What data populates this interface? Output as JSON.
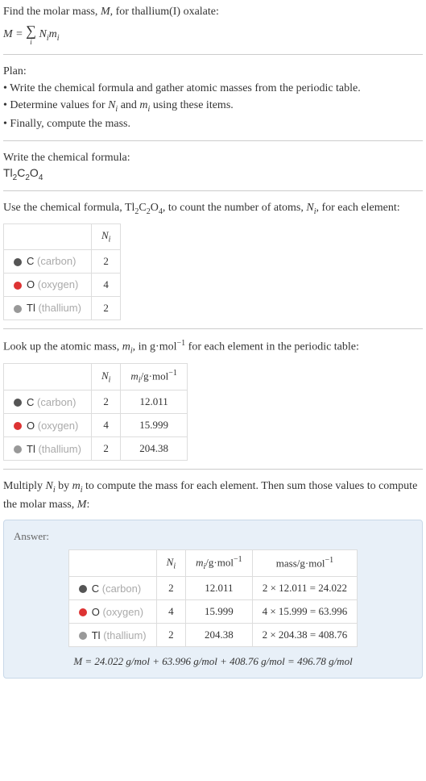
{
  "intro": {
    "line1_prefix": "Find the molar mass, ",
    "line1_var": "M",
    "line1_suffix": ", for thallium(I) oxalate:",
    "formula_lhs": "M",
    "formula_eq": " = ",
    "formula_sigma": "∑",
    "formula_sigma_sub": "i",
    "formula_rhs1": "N",
    "formula_rhs1_sub": "i",
    "formula_rhs2": "m",
    "formula_rhs2_sub": "i"
  },
  "plan": {
    "title": "Plan:",
    "bullet1": "• Write the chemical formula and gather atomic masses from the periodic table.",
    "bullet2_prefix": "• Determine values for ",
    "bullet2_var1": "N",
    "bullet2_var1_sub": "i",
    "bullet2_mid": " and ",
    "bullet2_var2": "m",
    "bullet2_var2_sub": "i",
    "bullet2_suffix": " using these items.",
    "bullet3": "• Finally, compute the mass."
  },
  "chemformula": {
    "title": "Write the chemical formula:",
    "formula": "Tl",
    "sub1": "2",
    "mid1": "C",
    "sub2": "2",
    "mid2": "O",
    "sub3": "4"
  },
  "count_section": {
    "text_prefix": "Use the chemical formula, Tl",
    "text_sub1": "2",
    "text_mid1": "C",
    "text_sub2": "2",
    "text_mid2": "O",
    "text_sub3": "4",
    "text_mid3": ", to count the number of atoms, ",
    "text_var": "N",
    "text_var_sub": "i",
    "text_suffix": ", for each element:"
  },
  "table1": {
    "header_ni": "N",
    "header_ni_sub": "i",
    "rows": [
      {
        "symbol": "C",
        "name": "(carbon)",
        "ni": "2",
        "dot": "dot-carbon"
      },
      {
        "symbol": "O",
        "name": "(oxygen)",
        "ni": "4",
        "dot": "dot-oxygen"
      },
      {
        "symbol": "Tl",
        "name": "(thallium)",
        "ni": "2",
        "dot": "dot-thallium"
      }
    ]
  },
  "lookup_section": {
    "text_prefix": "Look up the atomic mass, ",
    "text_var": "m",
    "text_var_sub": "i",
    "text_mid": ", in g·mol",
    "text_sup": "−1",
    "text_suffix": " for each element in the periodic table:"
  },
  "table2": {
    "header_ni": "N",
    "header_ni_sub": "i",
    "header_mi": "m",
    "header_mi_sub": "i",
    "header_mi_unit": "/g·mol",
    "header_mi_sup": "−1",
    "rows": [
      {
        "symbol": "C",
        "name": "(carbon)",
        "ni": "2",
        "mi": "12.011",
        "dot": "dot-carbon"
      },
      {
        "symbol": "O",
        "name": "(oxygen)",
        "ni": "4",
        "mi": "15.999",
        "dot": "dot-oxygen"
      },
      {
        "symbol": "Tl",
        "name": "(thallium)",
        "ni": "2",
        "mi": "204.38",
        "dot": "dot-thallium"
      }
    ]
  },
  "multiply_section": {
    "text_prefix": "Multiply ",
    "var1": "N",
    "var1_sub": "i",
    "mid1": " by ",
    "var2": "m",
    "var2_sub": "i",
    "mid2": " to compute the mass for each element. Then sum those values to compute the molar mass, ",
    "var3": "M",
    "suffix": ":"
  },
  "answer": {
    "label": "Answer:",
    "header_ni": "N",
    "header_ni_sub": "i",
    "header_mi": "m",
    "header_mi_sub": "i",
    "header_mi_unit": "/g·mol",
    "header_mi_sup": "−1",
    "header_mass": "mass/g·mol",
    "header_mass_sup": "−1",
    "rows": [
      {
        "symbol": "C",
        "name": "(carbon)",
        "ni": "2",
        "mi": "12.011",
        "mass": "2 × 12.011 = 24.022",
        "dot": "dot-carbon"
      },
      {
        "symbol": "O",
        "name": "(oxygen)",
        "ni": "4",
        "mi": "15.999",
        "mass": "4 × 15.999 = 63.996",
        "dot": "dot-oxygen"
      },
      {
        "symbol": "Tl",
        "name": "(thallium)",
        "ni": "2",
        "mi": "204.38",
        "mass": "2 × 204.38 = 408.76",
        "dot": "dot-thallium"
      }
    ],
    "final": "M = 24.022 g/mol + 63.996 g/mol + 408.76 g/mol = 496.78 g/mol"
  }
}
